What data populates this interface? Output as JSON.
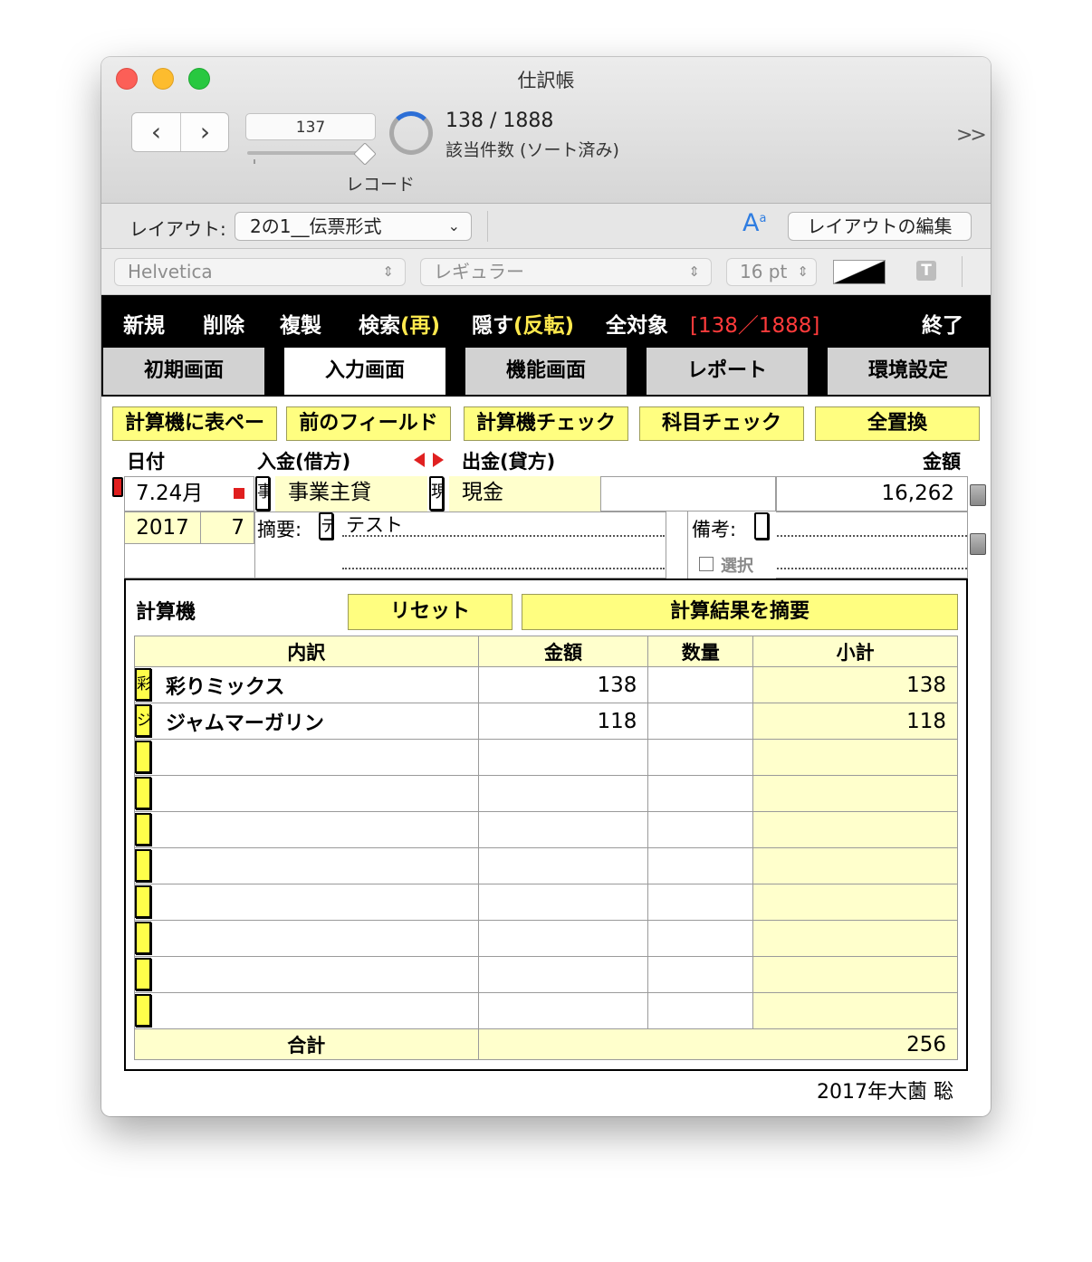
{
  "window": {
    "title": "仕訳帳"
  },
  "toolbar": {
    "record_value": "137",
    "record_count": "138 / 1888",
    "record_status": "該当件数 (ソート済み)",
    "record_label": "レコード",
    "overflow": ">>",
    "layout_label": "レイアウト:",
    "layout_value": "2の1__伝票形式",
    "edit_layout": "レイアウトの編集",
    "font": "Helvetica",
    "style": "レギュラー",
    "size": "16 pt"
  },
  "menu": {
    "new": "新規",
    "delete": "削除",
    "duplicate": "複製",
    "search": "検索",
    "search_re": "(再)",
    "hide": "隠す",
    "hide_invert": "(反転)",
    "all": "全対象",
    "count": "[138／1888]",
    "quit": "終了"
  },
  "tabs": [
    "初期画面",
    "入力画面",
    "機能画面",
    "レポート",
    "環境設定"
  ],
  "actions": [
    "計算機に表ペー",
    "前のフィールド",
    "計算機チェック",
    "科目チェック",
    "全置換"
  ],
  "entry": {
    "date_label": "日付",
    "debit_label": "入金(借方)",
    "credit_label": "出金(貸方)",
    "amount_label": "金額",
    "date": "7.24月",
    "debit_code": "事",
    "debit_account": "事業主貸",
    "credit_code": "現",
    "credit_account": "現金",
    "amount": "16,262",
    "year": "2017",
    "month": "7",
    "memo_label": "摘要:",
    "memo_code": "テ",
    "memo": "テスト",
    "note_label": "備考:",
    "select_label": "選択"
  },
  "calculator": {
    "title": "計算機",
    "reset": "リセット",
    "to_memo": "計算結果を摘要",
    "headers": [
      "内訳",
      "金額",
      "数量",
      "小計"
    ],
    "rows": [
      {
        "tab": "彩",
        "item": "彩りミックス",
        "amount": "138",
        "qty": "",
        "subtotal": "138"
      },
      {
        "tab": "ジ",
        "item": "ジャムマーガリン",
        "amount": "118",
        "qty": "",
        "subtotal": "118"
      },
      {
        "tab": "",
        "item": "",
        "amount": "",
        "qty": "",
        "subtotal": ""
      },
      {
        "tab": "",
        "item": "",
        "amount": "",
        "qty": "",
        "subtotal": ""
      },
      {
        "tab": "",
        "item": "",
        "amount": "",
        "qty": "",
        "subtotal": ""
      },
      {
        "tab": "",
        "item": "",
        "amount": "",
        "qty": "",
        "subtotal": ""
      },
      {
        "tab": "",
        "item": "",
        "amount": "",
        "qty": "",
        "subtotal": ""
      },
      {
        "tab": "",
        "item": "",
        "amount": "",
        "qty": "",
        "subtotal": ""
      },
      {
        "tab": "",
        "item": "",
        "amount": "",
        "qty": "",
        "subtotal": ""
      },
      {
        "tab": "",
        "item": "",
        "amount": "",
        "qty": "",
        "subtotal": ""
      }
    ],
    "total_label": "合計",
    "total": "256"
  },
  "footer": "2017年大薗 聡",
  "colors": {
    "accent_yellow": "#fffe80",
    "count_red": "#ff3b3b",
    "menu_yellow": "#ffe94d"
  }
}
